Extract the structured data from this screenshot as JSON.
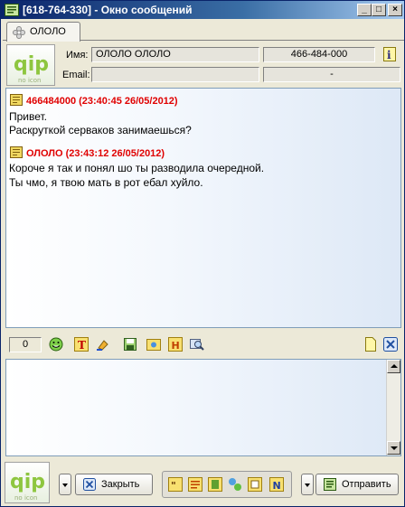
{
  "window": {
    "title": "[618-764-330] - Окно сообщений",
    "minimize_glyph": "_",
    "maximize_glyph": "□",
    "close_glyph": "×"
  },
  "tab": {
    "label": "ОЛОЛО"
  },
  "contact": {
    "logo_text": "qip",
    "logo_sub": "no icon",
    "name_label": "Имя:",
    "name_value": "ОЛОЛО ОЛОЛО",
    "uin_value": "466-484-000",
    "email_label": "Email:",
    "email_value": "",
    "extra_value": "-"
  },
  "messages": [
    {
      "header": "466484000 (23:40:45 26/05/2012)",
      "lines": [
        "Привет.",
        "Раскруткой серваков занимаешься?"
      ]
    },
    {
      "header": "ОЛОЛО (23:43:12 26/05/2012)",
      "lines": [
        "Короче я так и понял шо ты разводила очередной.",
        "Ты чмо, я твою мать в рот ебал хуйло."
      ]
    }
  ],
  "toolbar": {
    "char_count": "0",
    "icons": [
      "smile-icon",
      "font-icon",
      "color-icon",
      "save-icon",
      "snapshot-icon",
      "history-icon",
      "search-icon",
      "new-note-icon",
      "close-input-icon"
    ]
  },
  "buttons": {
    "close_label": "Закрыть",
    "send_label": "Отправить"
  },
  "colors": {
    "sender_color": "#e00000",
    "title_bar": "#0a246a",
    "border": "#7f9db9"
  }
}
